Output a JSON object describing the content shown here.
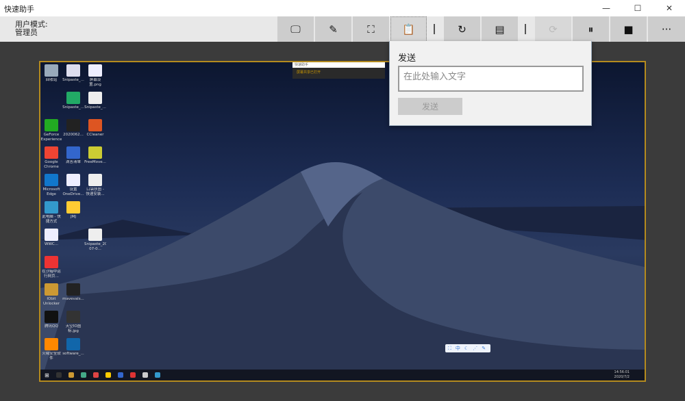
{
  "window": {
    "title": "快速助手",
    "minimize": "—",
    "maximize": "☐",
    "close": "✕"
  },
  "toolbar": {
    "mode_label": "用户模式:",
    "mode_value": "管理员",
    "buttons": [
      {
        "name": "screen",
        "icon": "monitor-icon",
        "glyph": "🖵"
      },
      {
        "name": "annotate",
        "icon": "edit-icon",
        "glyph": "✎"
      },
      {
        "name": "screenshot",
        "icon": "crop-icon",
        "glyph": "⛶"
      },
      {
        "name": "clipboard",
        "icon": "clipboard-icon",
        "glyph": "📋"
      },
      {
        "name": "restart",
        "icon": "refresh-icon",
        "glyph": "↻"
      },
      {
        "name": "task-manager",
        "icon": "window-icon",
        "glyph": "▤"
      },
      {
        "name": "sync",
        "icon": "sync-icon",
        "glyph": "⟳"
      },
      {
        "name": "pause",
        "icon": "pause-icon",
        "glyph": "⏸"
      },
      {
        "name": "stop",
        "icon": "stop-icon",
        "glyph": "■"
      },
      {
        "name": "more",
        "icon": "more-icon",
        "glyph": "···"
      }
    ]
  },
  "popup": {
    "title": "发送",
    "placeholder": "在此处输入文字",
    "value": "",
    "send_label": "发送"
  },
  "remote": {
    "mini_window": {
      "title": "快速助手",
      "status": "屏幕共享已打开"
    },
    "icons": [
      "回收站",
      "Snipaste_...",
      "屏幕设置.png",
      "Snipaste_...",
      "Snipaste_...",
      "GeForce Experience",
      "2020062...",
      "CCleaner",
      "Google Chrome",
      "滴答清单",
      "FreeMove...",
      "Microsoft Edge",
      "设置 OneDrive...",
      "口袋扶图 - 快速安装...",
      "此电脑 - 快捷方式",
      "JMJ",
      "WWC...",
      "Snipaste_2020-07-0...",
      "在沙箱中运行网页...",
      "IObit Unlocker",
      "mavevals...",
      "腾讯QQ",
      "天空IO图标.jpg",
      "火绒安全软件",
      "software_..."
    ],
    "clock": {
      "time": "14:56:01",
      "date": "2020/7/2"
    }
  }
}
